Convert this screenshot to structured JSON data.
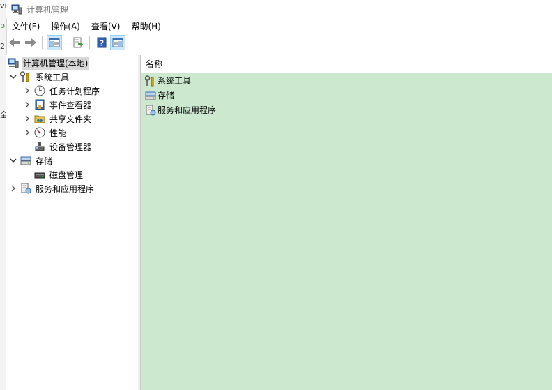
{
  "left_strip": {
    "glyphs": [
      "vi",
      "p",
      "2",
      "全"
    ]
  },
  "window": {
    "title": "计算机管理"
  },
  "menu": [
    "文件(F)",
    "操作(A)",
    "查看(V)",
    "帮助(H)"
  ],
  "toolbar": {
    "buttons": [
      "back-arrow-icon",
      "forward-arrow-icon",
      "show-hide-console-tree-icon",
      "export-list-icon",
      "help-icon",
      "show-hide-action-pane-icon"
    ]
  },
  "tree": {
    "root": {
      "label": "计算机管理(本地)",
      "icon": "computer-management-icon",
      "selected": true
    },
    "system_tools": {
      "label": "系统工具",
      "icon": "tools-icon",
      "expanded": true
    },
    "task_scheduler": {
      "label": "任务计划程序",
      "icon": "clock-icon"
    },
    "event_viewer": {
      "label": "事件查看器",
      "icon": "event-viewer-icon"
    },
    "shared_folders": {
      "label": "共享文件夹",
      "icon": "shared-folder-icon"
    },
    "performance": {
      "label": "性能",
      "icon": "performance-icon"
    },
    "device_manager": {
      "label": "设备管理器",
      "icon": "device-manager-icon"
    },
    "storage": {
      "label": "存储",
      "icon": "storage-icon",
      "expanded": true
    },
    "disk_management": {
      "label": "磁盘管理",
      "icon": "disk-icon"
    },
    "services_apps": {
      "label": "服务和应用程序",
      "icon": "services-icon"
    }
  },
  "list": {
    "column_name": "名称",
    "rows": [
      {
        "label": "系统工具",
        "icon": "tools-icon"
      },
      {
        "label": "存储",
        "icon": "storage-icon"
      },
      {
        "label": "服务和应用程序",
        "icon": "services-icon"
      }
    ],
    "background_color": "#cce8cf"
  }
}
